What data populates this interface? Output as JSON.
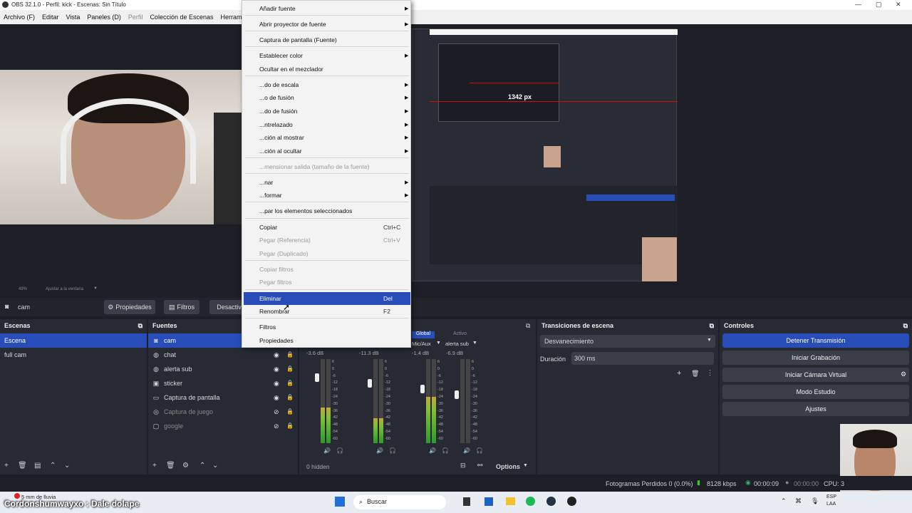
{
  "title": "OBS 32.1.0 - Perfil: kick - Escenas: Sin Título",
  "menu": [
    "Archivo (F)",
    "Editar",
    "Vista",
    "Paneles (D)",
    "Perfil",
    "Colección de Escenas",
    "Herramien"
  ],
  "preview": {
    "inner_label": "1342 px",
    "fit_label": "Ajustar a la ventana",
    "zoom": "49%"
  },
  "source_toolbar": {
    "current_source": "cam",
    "properties_label": "Propiedades",
    "filters_label": "Filtros",
    "deactivate_label": "Desactiva"
  },
  "scenes": {
    "title": "Escenas",
    "items": [
      "Escena",
      "full cam"
    ]
  },
  "sources": {
    "title": "Fuentes",
    "items": [
      {
        "name": "cam",
        "icon": "camera-icon"
      },
      {
        "name": "chat",
        "icon": "globe-icon"
      },
      {
        "name": "alerta sub",
        "icon": "globe-icon"
      },
      {
        "name": "sticker",
        "icon": "image-icon"
      },
      {
        "name": "Captura de pantalla",
        "icon": "monitor-icon"
      },
      {
        "name": "Captura de juego",
        "icon": "gamepad-icon"
      },
      {
        "name": "google",
        "icon": "window-icon"
      }
    ]
  },
  "mixer": {
    "tabs": [
      "Global",
      "Activo"
    ],
    "channels": [
      {
        "db": "-3.6 dB",
        "level": 0.42
      },
      {
        "db": "-11.3 dB",
        "level": 0.3
      },
      {
        "db": "-1.4 dB",
        "label": "Mic/Aux",
        "level": 0.55
      },
      {
        "db": "-6.9 dB",
        "label": "alerta sub",
        "level": 0.0
      }
    ],
    "scale": [
      "6",
      "0",
      "-6",
      "-12",
      "-18",
      "-24",
      "-30",
      "-36",
      "-42",
      "-48",
      "-54",
      "-60"
    ],
    "hidden": "0 hidden",
    "options": "Options"
  },
  "transitions": {
    "title": "Transiciones de escena",
    "selected": "Desvanecimiento",
    "duration_label": "Duración",
    "duration_value": "300 ms"
  },
  "controls": {
    "title": "Controles",
    "buttons": [
      "Detener Transmisión",
      "Iniciar Grabación",
      "Iniciar Cámara Virtual",
      "Modo Estudio",
      "Ajustes"
    ]
  },
  "context_menu": {
    "items": [
      {
        "label": "Añadir fuente",
        "sub": true
      },
      {
        "label": "Abrir proyector de fuente",
        "sub": true
      },
      {
        "label": "Captura de pantalla (Fuente)"
      },
      {
        "label": "Establecer color",
        "sub": true
      },
      {
        "label": "Ocultar en el mezclador"
      },
      {
        "label": "...do de escala",
        "sub": true
      },
      {
        "label": "...o de fusión",
        "sub": true
      },
      {
        "label": "...do de fusión",
        "sub": true
      },
      {
        "label": "...ntrelazado",
        "sub": true
      },
      {
        "label": "...ción al mostrar",
        "sub": true
      },
      {
        "label": "...ción al ocultar",
        "sub": true
      },
      {
        "label": "...mensionar salida (tamaño de la fuente)",
        "disabled": true
      },
      {
        "label": "...nar",
        "sub": true
      },
      {
        "label": "...formar",
        "sub": true
      },
      {
        "label": "...par los elementos seleccionados"
      },
      {
        "label": "Copiar",
        "shortcut": "Ctrl+C"
      },
      {
        "label": "Pegar (Referencia)",
        "shortcut": "Ctrl+V",
        "disabled": true
      },
      {
        "label": "Pegar (Duplicado)",
        "disabled": true
      },
      {
        "label": "Copiar filtros",
        "disabled": true
      },
      {
        "label": "Pegar filtros",
        "disabled": true
      },
      {
        "label": "Eliminar",
        "shortcut": "Del",
        "selected": true
      },
      {
        "label": "Renombrar",
        "shortcut": "F2"
      },
      {
        "label": "Filtros"
      },
      {
        "label": "Propiedades"
      }
    ]
  },
  "status": {
    "dropped": "Fotogramas Perdidos 0 (0.0%)",
    "kbps": "8128 kbps",
    "stream_time": "00:00:09",
    "rec_time": "00:00:00",
    "cpu": "CPU: 3"
  },
  "taskbar": {
    "search": "Buscar",
    "lang": "ESP",
    "lang2": "LAA",
    "weather": "5 mm de lluvia",
    "overlay_text": "Cordonshumwayxo : Dale dolape"
  },
  "colors": {
    "accent": "#284cb8",
    "red_line": "#d01010"
  }
}
